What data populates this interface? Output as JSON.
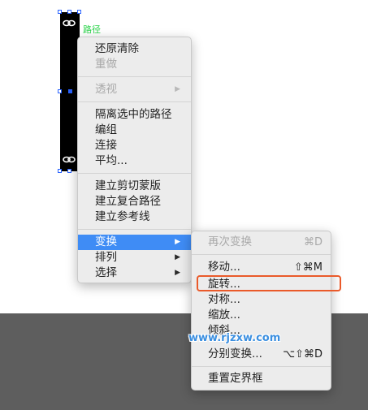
{
  "canvas": {
    "path_label": "路径"
  },
  "context_menu": {
    "restore_clear": "还原清除",
    "redo": "重做",
    "perspective": "透视",
    "isolate_path": "隔离选中的路径",
    "group": "编组",
    "join": "连接",
    "average": "平均...",
    "make_clipping_mask": "建立剪切蒙版",
    "make_compound_path": "建立复合路径",
    "make_guides": "建立参考线",
    "transform": "变换",
    "arrange": "排列",
    "select": "选择",
    "submenu_arrow": "▶"
  },
  "transform_submenu": {
    "transform_again": "再次变换",
    "transform_again_shortcut": "⌘D",
    "move": "移动...",
    "move_shortcut": "⇧⌘M",
    "rotate": "旋转...",
    "reflect": "对称...",
    "scale": "缩放...",
    "shear": "倾斜...",
    "transform_each": "分别变换...",
    "transform_each_shortcut": "⌥⇧⌘D",
    "reset_bounding_box": "重置定界框"
  },
  "watermark": "www.rjzxw.com",
  "colors": {
    "accent": "#3f8cf5",
    "highlight_box": "#ea5a2a",
    "path_label": "#2ad44a",
    "selection": "#2a63ff"
  }
}
